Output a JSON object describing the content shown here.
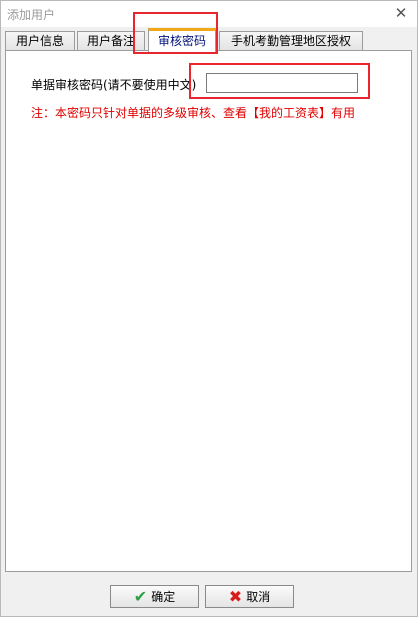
{
  "window": {
    "title": "添加用户"
  },
  "tabs": [
    {
      "label": "用户信息"
    },
    {
      "label": "用户备注"
    },
    {
      "label": "审核密码"
    },
    {
      "label": "手机考勤管理地区授权"
    }
  ],
  "panel": {
    "password_label": "单据审核密码(请不要使用中文)",
    "password_value": "",
    "note": "注：本密码只针对单据的多级审核、查看【我的工资表】有用"
  },
  "buttons": {
    "ok_label": "确定",
    "cancel_label": "取消"
  },
  "colors": {
    "active_tab_accent": "#f0a818",
    "note_text": "#e00000",
    "highlight_box": "#e8262f"
  },
  "icons": {
    "ok": "check-icon",
    "cancel": "x-icon"
  }
}
